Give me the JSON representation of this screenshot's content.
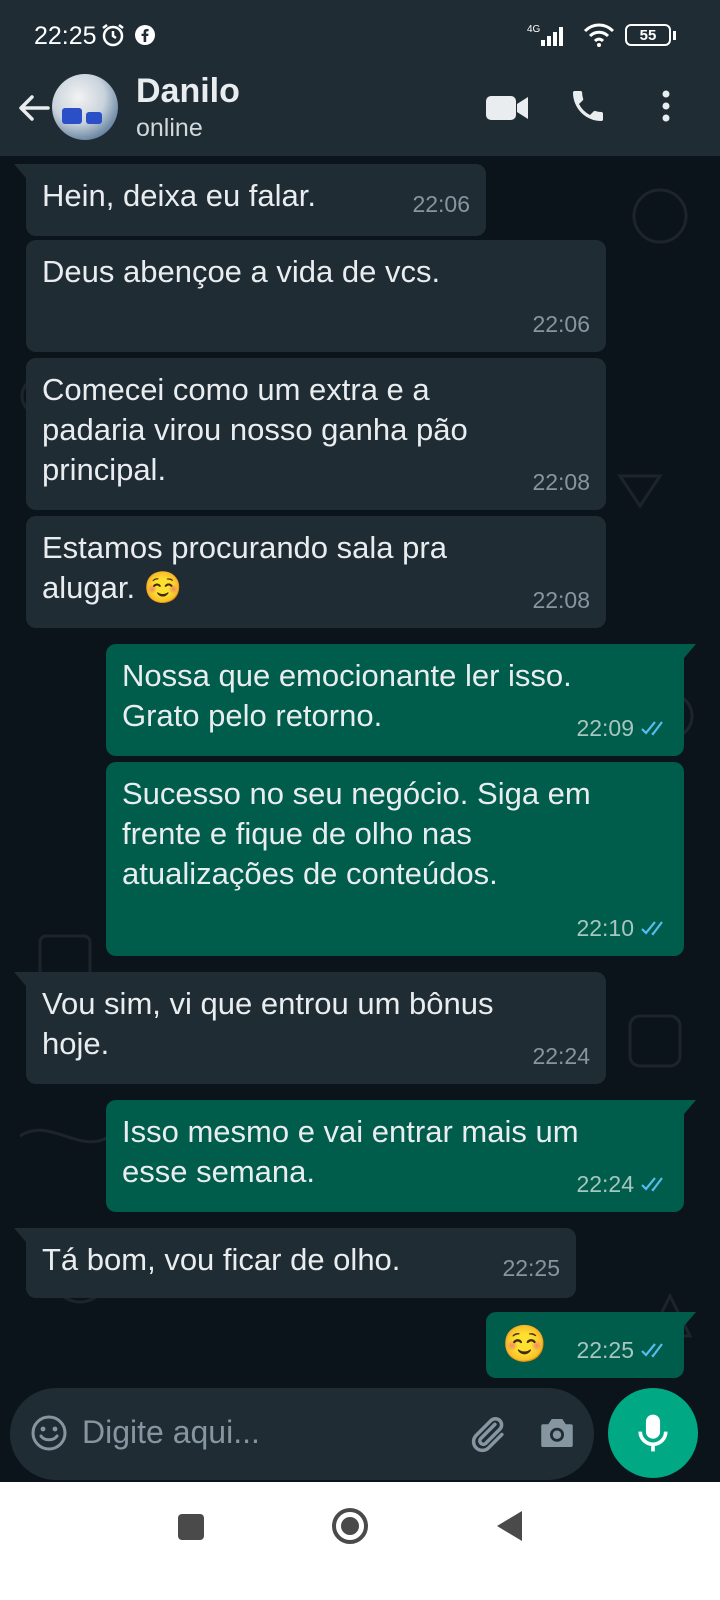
{
  "status_bar": {
    "time": "22:25",
    "network": "4G",
    "battery": "55",
    "icons": [
      "alarm-icon",
      "facebook-icon",
      "signal-icon",
      "wifi-icon",
      "battery-icon"
    ]
  },
  "header": {
    "contact_name": "Danilo",
    "contact_status": "online",
    "icons": [
      "back-arrow-icon",
      "video-call-icon",
      "phone-icon",
      "more-vert-icon"
    ]
  },
  "messages": [
    {
      "direction": "in",
      "text": "Hein, deixa eu falar.",
      "time": "22:06"
    },
    {
      "direction": "in",
      "text": "Deus abençoe a vida de vcs.",
      "time": "22:06"
    },
    {
      "direction": "in",
      "text": "Comecei como um extra e a padaria virou nosso ganha pão principal.",
      "time": "22:08"
    },
    {
      "direction": "in",
      "text": "Estamos procurando sala pra alugar. ☺️",
      "time": "22:08"
    },
    {
      "direction": "out",
      "text": "Nossa que emocionante ler isso. Grato pelo retorno.",
      "time": "22:09",
      "status": "read"
    },
    {
      "direction": "out",
      "text": "Sucesso no seu negócio. Siga em frente e fique de olho nas atualizações de conteúdos.",
      "time": "22:10",
      "status": "read"
    },
    {
      "direction": "in",
      "text": "Vou sim, vi que entrou um bônus hoje.",
      "time": "22:24"
    },
    {
      "direction": "out",
      "text": "Isso mesmo e vai entrar mais um esse semana.",
      "time": "22:24",
      "status": "read"
    },
    {
      "direction": "in",
      "text": "Tá bom, vou ficar de olho.",
      "time": "22:25"
    },
    {
      "direction": "out",
      "text": "☺️",
      "time": "22:25",
      "status": "read"
    }
  ],
  "composer": {
    "placeholder": "Digite aqui...",
    "icons": [
      "emoji-icon",
      "attach-icon",
      "camera-icon",
      "mic-icon"
    ]
  },
  "nav_bar": {
    "icons": [
      "recents-square-icon",
      "home-circle-icon",
      "back-triangle-icon"
    ]
  },
  "colors": {
    "header_bg": "#1f2c34",
    "chat_bg": "#0b141a",
    "incoming_bubble": "#202c33",
    "outgoing_bubble": "#005c4b",
    "accent": "#00a884",
    "read_tick": "#53bdeb"
  }
}
